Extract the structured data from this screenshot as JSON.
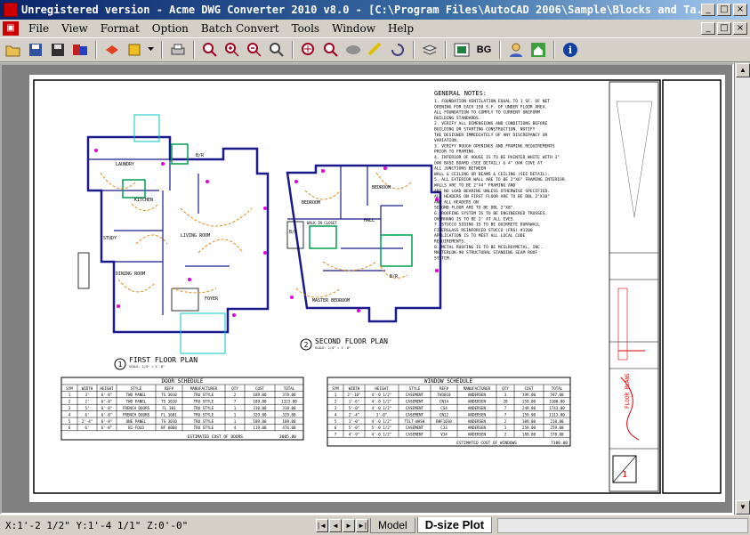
{
  "window": {
    "title": "Unregistered version - Acme DWG Converter 2010 v8.0 - [C:\\Program Files\\AutoCAD 2006\\Sample\\Blocks and Ta...",
    "minimize": "_",
    "maximize": "□",
    "close": "×"
  },
  "menu": [
    "File",
    "View",
    "Format",
    "Option",
    "Batch Convert",
    "Tools",
    "Window",
    "Help"
  ],
  "toolbar": {
    "bg_label": "BG"
  },
  "drawing": {
    "plan1_num": "1",
    "plan1_title": "FIRST FLOOR PLAN",
    "plan1_scale": "SCALE: 1/4\" = 1'-0\"",
    "plan2_num": "2",
    "plan2_title": "SECOND FLOOR PLAN",
    "plan2_scale": "SCALE: 1/4\" = 1'-0\"",
    "rooms1": [
      "LAUNDRY",
      "KITCHEN",
      "B/R",
      "STUDY",
      "LIVING ROOM",
      "DINING ROOM",
      "FOYER"
    ],
    "rooms2": [
      "BEDROOM",
      "BEDROOM",
      "B/R",
      "WALK-IN CLOSET",
      "HALL",
      "B/R",
      "MASTER BEDROOM"
    ],
    "notes_title": "GENERAL NOTES:",
    "notes": [
      "1. FOUNDATION VENTILATION EQUAL TO 1 SF. OF NET",
      "   OPENING FOR EACH 150 S.F. OF UNDER FLOOR AREA.",
      "   ALL FOUNDATION TO COMPLY TO CURRENT UNIFORM",
      "   BUILDING STANDARDS.",
      "2. VERIFY ALL DIMENSIONS AND CONDITIONS BEFORE",
      "   BUILDING OR STARTING CONSTRUCTION. NOTIFY",
      "   THE DESIGNER IMMEDIATELY OF ANY DISCREPANCY OR",
      "   VARIATION.",
      "3. VERIFY ROUGH OPENINGS AND FRAMING REQUIREMENTS",
      "   PRIOR TO FRAMING.",
      "4. INTERIOR OF HOUSE IS TO BE PAINTED WHITE WITH 3\"",
      "   OAK BASE BOARD (SEE DETAIL) & 4\" OAK COVE AT",
      "   ALL JUNCTIONS BETWEEN",
      "   WALL & CEILING OR BEAMS & CEILING (SEE DETAIL).",
      "5. ALL EXTERIOR WALL ARE TO BE 2\"X6\" FRAMING INTERIOR",
      "   WALLS ARE TO BE 2\"X4\" FRAMING AND",
      "   ARE NO LOAD BEARING UNLESS OTHERWISE SPECIFIED.",
      "   ALL HEADERS ON FIRST FLOOR ARE TO BE DBL 2\"X10\"",
      "   AND ALL HEADERS ON",
      "   SECOND FLOOR ARE TO BE DBL 2\"X8\".",
      "6. ROOFING SYSTEM IS TO BE ENGINEERED TRUSSES.",
      "   OVERHANG IS TO BE 2' AT ALL EVES.",
      "7. STUCCO SIDING IS TO BE QUIKRETE DURAWALL",
      "   FIBERGLASS REINFORCED STUCCO (FRS) #1200",
      "   APPLICATION IS TO MEET ALL LOCAL CODE",
      "   REQUIREMENTS.",
      "8. METAL ROOFING IS TO BE MCELROYMETAL, INC.",
      "   MASTERLOK-90 STRUCTURAL STANDING SEAM ROOF",
      "   SYSTEM."
    ],
    "door_schedule": {
      "title": "DOOR SCHEDULE",
      "headers": [
        "SYM",
        "WIDTH",
        "HEIGHT",
        "STYLE",
        "REF#",
        "MANUFACTURER",
        "QTY",
        "COST",
        "TOTAL"
      ],
      "rows": [
        [
          "1",
          "3'",
          "6'-8\"",
          "TWO PANEL",
          "TS 3010",
          "TRU STYLE",
          "2",
          "189.00",
          "378.00"
        ],
        [
          "2",
          "2'",
          "6'-8\"",
          "TWO PANEL",
          "TS 3010",
          "TRU STYLE",
          "7",
          "189.00",
          "1323.00"
        ],
        [
          "3",
          "5'",
          "6'-8\"",
          "FRENCH DOORS",
          "FL 301",
          "TRU STYLE",
          "1",
          "310.00",
          "310.00"
        ],
        [
          "4",
          "6'",
          "6'-8\"",
          "FRENCH DOORS",
          "FL 1601",
          "TRU STYLE",
          "1",
          "329.00",
          "329.00"
        ],
        [
          "5",
          "2'-4\"",
          "6'-8\"",
          "ONE PANEL",
          "TS 3010",
          "TRU STYLE",
          "1",
          "189.00",
          "189.00"
        ],
        [
          "6",
          "6'",
          "6'-8\"",
          "BI-FOLD",
          "BF 6068",
          "TRU STYLE",
          "4",
          "119.00",
          "476.00"
        ]
      ],
      "footer": "ESTIMATED COST OF DOORS",
      "footer_total": "3005.00"
    },
    "window_schedule": {
      "title": "WINDOW SCHEDULE",
      "headers": [
        "SYM",
        "WIDTH",
        "HEIGHT",
        "STYLE",
        "REF#",
        "MANUFACTURER",
        "QTY",
        "COST",
        "TOTAL"
      ],
      "rows": [
        [
          "1",
          "2'-10\"",
          "4'-0 1/2\"",
          "CASEMENT",
          "TW3010",
          "ANDERSEN",
          "3",
          "199.00",
          "597.00"
        ],
        [
          "2",
          "1'-6\"",
          "4'-0 1/2\"",
          "CASEMENT",
          "CN14",
          "ANDERSEN",
          "20",
          "159.00",
          "3180.00"
        ],
        [
          "3",
          "5'-0\"",
          "4'-0 1/2\"",
          "CASEMENT",
          "CS4",
          "ANDERSEN",
          "7",
          "249.00",
          "1743.00"
        ],
        [
          "4",
          "2'-4\"",
          "3'-0\"",
          "CASEMENT",
          "CN12",
          "ANDERSEN",
          "7",
          "159.00",
          "1113.00"
        ],
        [
          "5",
          "1'-0\"",
          "4'-0 1/2\"",
          "TILT-WASH",
          "BHF1010",
          "ANDERSEN",
          "2",
          "109.00",
          "218.00"
        ],
        [
          "6",
          "5'-0\"",
          "5'-0 1/2\"",
          "CASEMENT",
          "C33",
          "ANDERSEN",
          "1",
          "259.00",
          "259.00"
        ],
        [
          "7",
          "4'-9\"",
          "4'-0 1/2\"",
          "CASEMENT",
          "V34",
          "ANDERSEN",
          "2",
          "189.00",
          "378.00"
        ]
      ],
      "footer": "ESTIMATED COST OF WINDOWS",
      "footer_total": "7388.00"
    },
    "sheet_label": "FLOOR PLANS",
    "sheet_num": "1"
  },
  "status": {
    "coords": "X:1'-2 1/2\" Y:1'-4 1/1\" Z:0'-0\""
  },
  "tabs": [
    "Model",
    "D-size Plot"
  ],
  "colors": {
    "title_start": "#0a246a",
    "title_end": "#a6caf0",
    "door_arc": "#e08a1e",
    "wall": "#1a1a8c",
    "outlet": "#e000e0",
    "fixture": "#00a050",
    "redline": "#e00000"
  }
}
